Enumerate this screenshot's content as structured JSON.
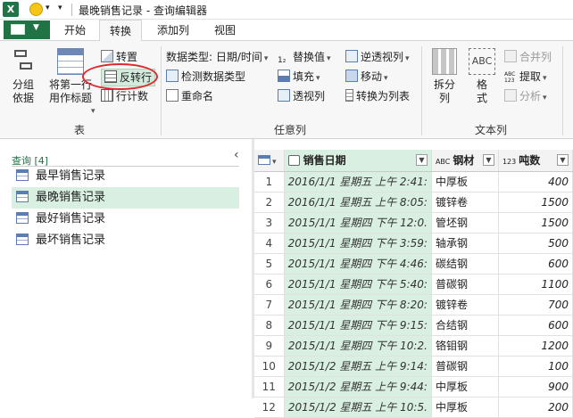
{
  "window": {
    "title": "最晚销售记录 - 查询编辑器"
  },
  "ribbon_tabs": [
    "开始",
    "转换",
    "添加列",
    "视图"
  ],
  "ribbon": {
    "table_group": {
      "label": "表",
      "group_by": "分组\n依据",
      "first_row_header": "将第一行\n用作标题",
      "transpose": "转置",
      "reverse_rows": "反转行",
      "count_rows": "行计数"
    },
    "any_column_group": {
      "label": "任意列",
      "data_type": "数据类型: 日期/时间",
      "detect_type": "检测数据类型",
      "rename": "重命名",
      "replace_values": "替换值",
      "fill": "填充",
      "pivot_column": "透视列",
      "unpivot": "逆透视列",
      "move": "移动",
      "to_list": "转换为列表"
    },
    "text_column_group": {
      "label": "文本列",
      "split_column": "拆分\n列",
      "format": "格\n式",
      "merge_columns": "合并列",
      "extract": "提取",
      "parse": "分析"
    }
  },
  "queries": {
    "header": "查询 [4]",
    "items": [
      "最早销售记录",
      "最晚销售记录",
      "最好销售记录",
      "最坏销售记录"
    ],
    "selected_index": 1
  },
  "table": {
    "columns": [
      {
        "type_icon": "日期时间",
        "name": "销售日期"
      },
      {
        "type_icon": "ABC",
        "name": "钢材"
      },
      {
        "type_icon": "123",
        "name": "吨数"
      }
    ],
    "rows": [
      [
        "1",
        "2016/1/1 星期五 上午 2:41:",
        "中厚板",
        "400"
      ],
      [
        "2",
        "2016/1/1 星期五 上午 8:05:",
        "镀锌卷",
        "1500"
      ],
      [
        "3",
        "2015/1/1 星期四 下午 12:0.",
        "管坯钢",
        "1500"
      ],
      [
        "4",
        "2015/1/1 星期四 下午 3:59:",
        "轴承钢",
        "500"
      ],
      [
        "5",
        "2015/1/1 星期四 下午 4:46:",
        "碳结钢",
        "600"
      ],
      [
        "6",
        "2015/1/1 星期四 下午 5:40:",
        "普碳钢",
        "1100"
      ],
      [
        "7",
        "2015/1/1 星期四 下午 8:20:",
        "镀锌卷",
        "700"
      ],
      [
        "8",
        "2015/1/1 星期四 下午 9:15:",
        "合结钢",
        "600"
      ],
      [
        "9",
        "2015/1/1 星期四 下午 10:2.",
        "铬钼钢",
        "1200"
      ],
      [
        "10",
        "2015/1/2 星期五 上午 9:14:",
        "普碳钢",
        "100"
      ],
      [
        "11",
        "2015/1/2 星期五 上午 9:44:",
        "中厚板",
        "900"
      ],
      [
        "12",
        "2015/1/2 星期五 上午 10:5.",
        "中厚板",
        "200"
      ]
    ]
  },
  "colors": {
    "accent": "#217346",
    "selection": "#d8efe1",
    "highlight_ring": "#e0282e"
  }
}
